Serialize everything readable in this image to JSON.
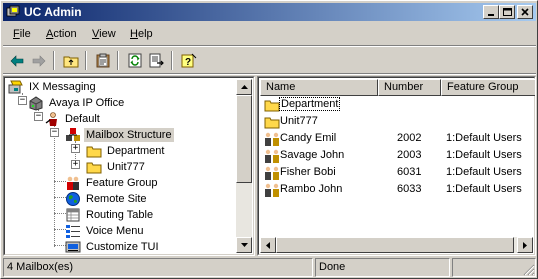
{
  "window": {
    "title": "UC Admin"
  },
  "menus": [
    {
      "label": "File",
      "key": "F",
      "rest": "ile"
    },
    {
      "label": "Action",
      "key": "A",
      "rest": "ction"
    },
    {
      "label": "View",
      "key": "V",
      "rest": "iew"
    },
    {
      "label": "Help",
      "key": "H",
      "rest": "elp"
    }
  ],
  "toolbar": [
    "back-arrow-icon",
    "forward-arrow-icon",
    "up-folder-icon",
    "clipboard-icon",
    "refresh-icon",
    "export-list-icon",
    "help-icon"
  ],
  "tree": [
    {
      "label": "IX Messaging",
      "icon": "ix-messaging-icon",
      "level": 0,
      "expander": ""
    },
    {
      "label": "Avaya IP Office",
      "icon": "server-icon",
      "level": 1,
      "expander": "−"
    },
    {
      "label": "Default",
      "icon": "person-icon",
      "level": 2,
      "expander": "−"
    },
    {
      "label": "Mailbox Structure",
      "icon": "mailbox-structure-icon",
      "level": 3,
      "expander": "−",
      "selected": true
    },
    {
      "label": "Department",
      "icon": "folder-icon",
      "level": 4,
      "expander": "+"
    },
    {
      "label": "Unit777",
      "icon": "folder-icon",
      "level": 4,
      "expander": "+"
    },
    {
      "label": "Feature Group",
      "icon": "feature-group-icon",
      "level": 3,
      "expander": ""
    },
    {
      "label": "Remote Site",
      "icon": "globe-icon",
      "level": 3,
      "expander": ""
    },
    {
      "label": "Routing Table",
      "icon": "table-icon",
      "level": 3,
      "expander": ""
    },
    {
      "label": "Voice Menu",
      "icon": "voice-menu-icon",
      "level": 3,
      "expander": ""
    },
    {
      "label": "Customize TUI",
      "icon": "customize-icon",
      "level": 3,
      "expander": ""
    }
  ],
  "list": {
    "columns": [
      "Name",
      "Number",
      "Feature Group"
    ],
    "rows": [
      {
        "name": "Department",
        "number": "",
        "group": "",
        "icon": "folder-icon"
      },
      {
        "name": "Unit777",
        "number": "",
        "group": "",
        "icon": "folder-icon"
      },
      {
        "name": "Candy Emil",
        "number": "2002",
        "group": "1:Default Users",
        "icon": "mailbox-icon"
      },
      {
        "name": "Savage John",
        "number": "2003",
        "group": "1:Default Users",
        "icon": "mailbox-icon"
      },
      {
        "name": "Fisher Bobi",
        "number": "6031",
        "group": "1:Default Users",
        "icon": "mailbox-icon"
      },
      {
        "name": "Rambo John",
        "number": "6033",
        "group": "1:Default Users",
        "icon": "mailbox-icon"
      }
    ]
  },
  "status": {
    "count": "4 Mailbox(es)",
    "state": "Done"
  }
}
